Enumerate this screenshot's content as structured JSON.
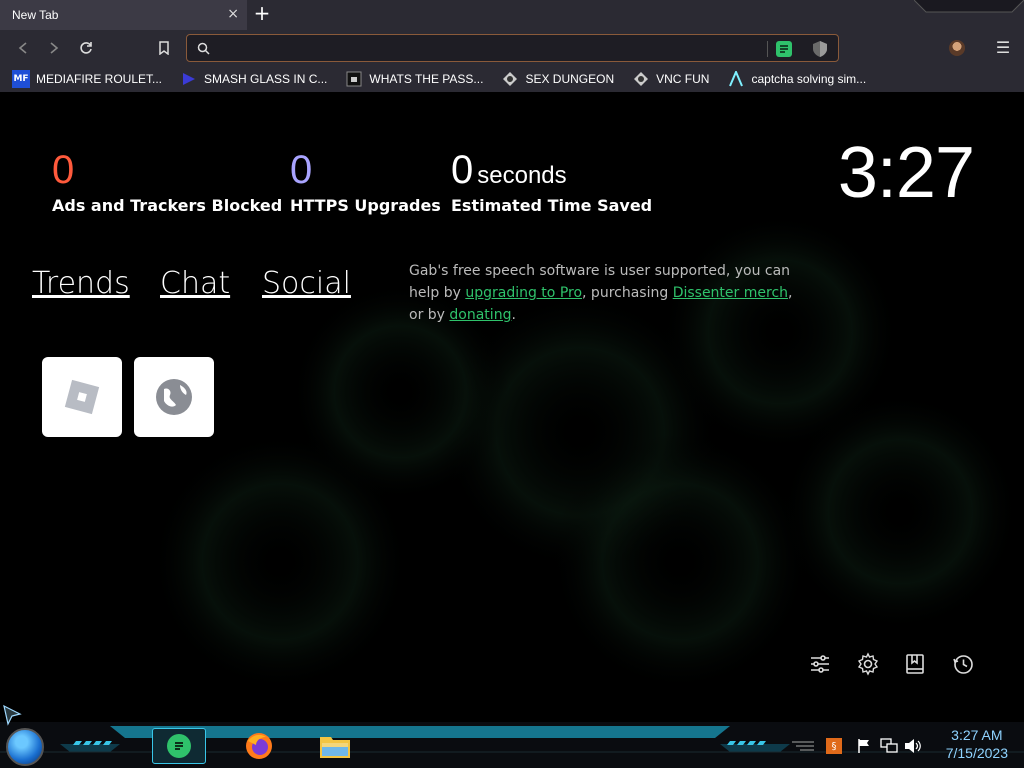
{
  "window": {
    "tab_title": "New Tab",
    "tab_close_glyph": "×",
    "new_tab_glyph": "+"
  },
  "toolbar": {
    "url_value": "",
    "url_placeholder": "",
    "back_icon": "back-arrow-icon",
    "forward_icon": "forward-arrow-icon",
    "reload_icon": "reload-icon",
    "bookmark_icon": "bookmark-icon",
    "menu_glyph": "☰"
  },
  "bookmarks": [
    {
      "label": "MEDIAFIRE ROULET...",
      "icon": "mediafire-icon"
    },
    {
      "label": "SMASH GLASS IN C...",
      "icon": "smash-icon"
    },
    {
      "label": "WHATS THE PASS...",
      "icon": "pass-icon"
    },
    {
      "label": "SEX DUNGEON",
      "icon": "dungeon-icon"
    },
    {
      "label": "VNC FUN",
      "icon": "vnc-icon"
    },
    {
      "label": "captcha solving sim...",
      "icon": "captcha-icon"
    }
  ],
  "stats": {
    "ads_blocked": {
      "value": "0",
      "label": "Ads and Trackers Blocked",
      "color": "#ff5a3c"
    },
    "https_upgrades": {
      "value": "0",
      "label": "HTTPS Upgrades",
      "color": "#a9a4ff"
    },
    "time_saved": {
      "value": "0",
      "unit": "seconds",
      "label": "Estimated Time Saved",
      "color": "#ffffff"
    }
  },
  "clock": "3:27",
  "links": {
    "trends": "Trends",
    "chat": "Chat",
    "social": "Social"
  },
  "gab_message": {
    "part1": "Gab's free speech software is user supported, you can help by ",
    "link1": "upgrading to Pro",
    "part2": ", purchasing ",
    "link2": "Dissenter merch",
    "part3": ", or by ",
    "link3": "donating",
    "part4": "."
  },
  "tiles": [
    {
      "name": "roblox",
      "icon": "roblox-icon"
    },
    {
      "name": "globe",
      "icon": "globe-icon"
    }
  ],
  "corner_icons": [
    "customize-icon",
    "settings-icon",
    "bookmarks-icon",
    "history-icon"
  ],
  "taskbar": {
    "time": "3:27 AM",
    "date": "7/15/2023"
  }
}
